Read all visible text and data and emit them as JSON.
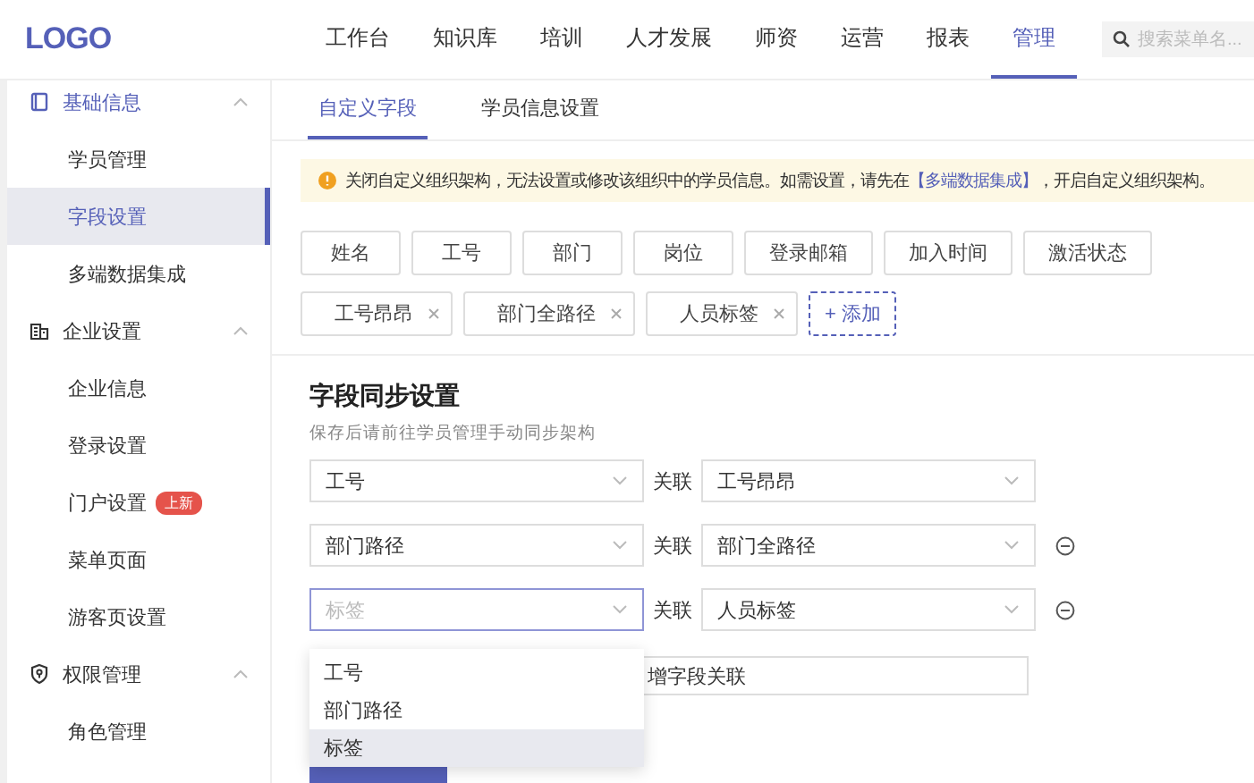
{
  "header": {
    "logo": "LOGO",
    "nav": [
      {
        "label": "工作台",
        "selected": false
      },
      {
        "label": "知识库",
        "selected": false
      },
      {
        "label": "培训",
        "selected": false
      },
      {
        "label": "人才发展",
        "selected": false
      },
      {
        "label": "师资",
        "selected": false
      },
      {
        "label": "运营",
        "selected": false
      },
      {
        "label": "报表",
        "selected": false
      },
      {
        "label": "管理",
        "selected": true
      }
    ],
    "search": {
      "placeholder": "搜索菜单名..."
    }
  },
  "sidebar": {
    "groups": [
      {
        "label": "基础信息",
        "active": true,
        "expanded": true,
        "items": [
          {
            "label": "学员管理",
            "selected": false
          },
          {
            "label": "字段设置",
            "selected": true
          },
          {
            "label": "多端数据集成",
            "selected": false
          }
        ]
      },
      {
        "label": "企业设置",
        "active": false,
        "expanded": true,
        "items": [
          {
            "label": "企业信息",
            "selected": false
          },
          {
            "label": "登录设置",
            "selected": false
          },
          {
            "label": "门户设置",
            "selected": false,
            "badge": "上新"
          },
          {
            "label": "菜单页面",
            "selected": false
          },
          {
            "label": "游客页设置",
            "selected": false
          }
        ]
      },
      {
        "label": "权限管理",
        "active": false,
        "expanded": true,
        "items": [
          {
            "label": "角色管理",
            "selected": false
          }
        ]
      }
    ]
  },
  "tabs": [
    {
      "label": "自定义字段",
      "selected": true
    },
    {
      "label": "学员信息设置",
      "selected": false
    }
  ],
  "alert": {
    "text": "关闭自定义组织架构，无法设置或修改该组织中的学员信息。如需设置，请先在",
    "link": "【多端数据集成】",
    "after": "，开启自定义组织架构。"
  },
  "fields": {
    "fixed": [
      "姓名",
      "工号",
      "部门",
      "岗位",
      "登录邮箱",
      "加入时间",
      "激活状态"
    ],
    "custom": [
      "工号昂昂",
      "部门全路径",
      "人员标签"
    ],
    "add_button": "+ 添加"
  },
  "sync": {
    "title": "字段同步设置",
    "subtitle": "保存后请前往学员管理手动同步架构",
    "rows": [
      {
        "source": {
          "value": "工号",
          "focused": false
        },
        "relation": "关联",
        "target": "工号昂昂",
        "removable": false
      },
      {
        "source": {
          "value": "部门路径",
          "focused": false
        },
        "relation": "关联",
        "target": "部门全路径",
        "removable": true
      },
      {
        "source": {
          "placeholder": "标签",
          "focused": true
        },
        "relation": "关联",
        "target": "人员标签",
        "removable": true
      }
    ],
    "add_button": "增字段关联",
    "dropdown": {
      "open": true,
      "options": [
        {
          "label": "工号",
          "selected": false
        },
        {
          "label": "部门路径",
          "selected": false
        },
        {
          "label": "标签",
          "selected": true
        }
      ]
    }
  }
}
